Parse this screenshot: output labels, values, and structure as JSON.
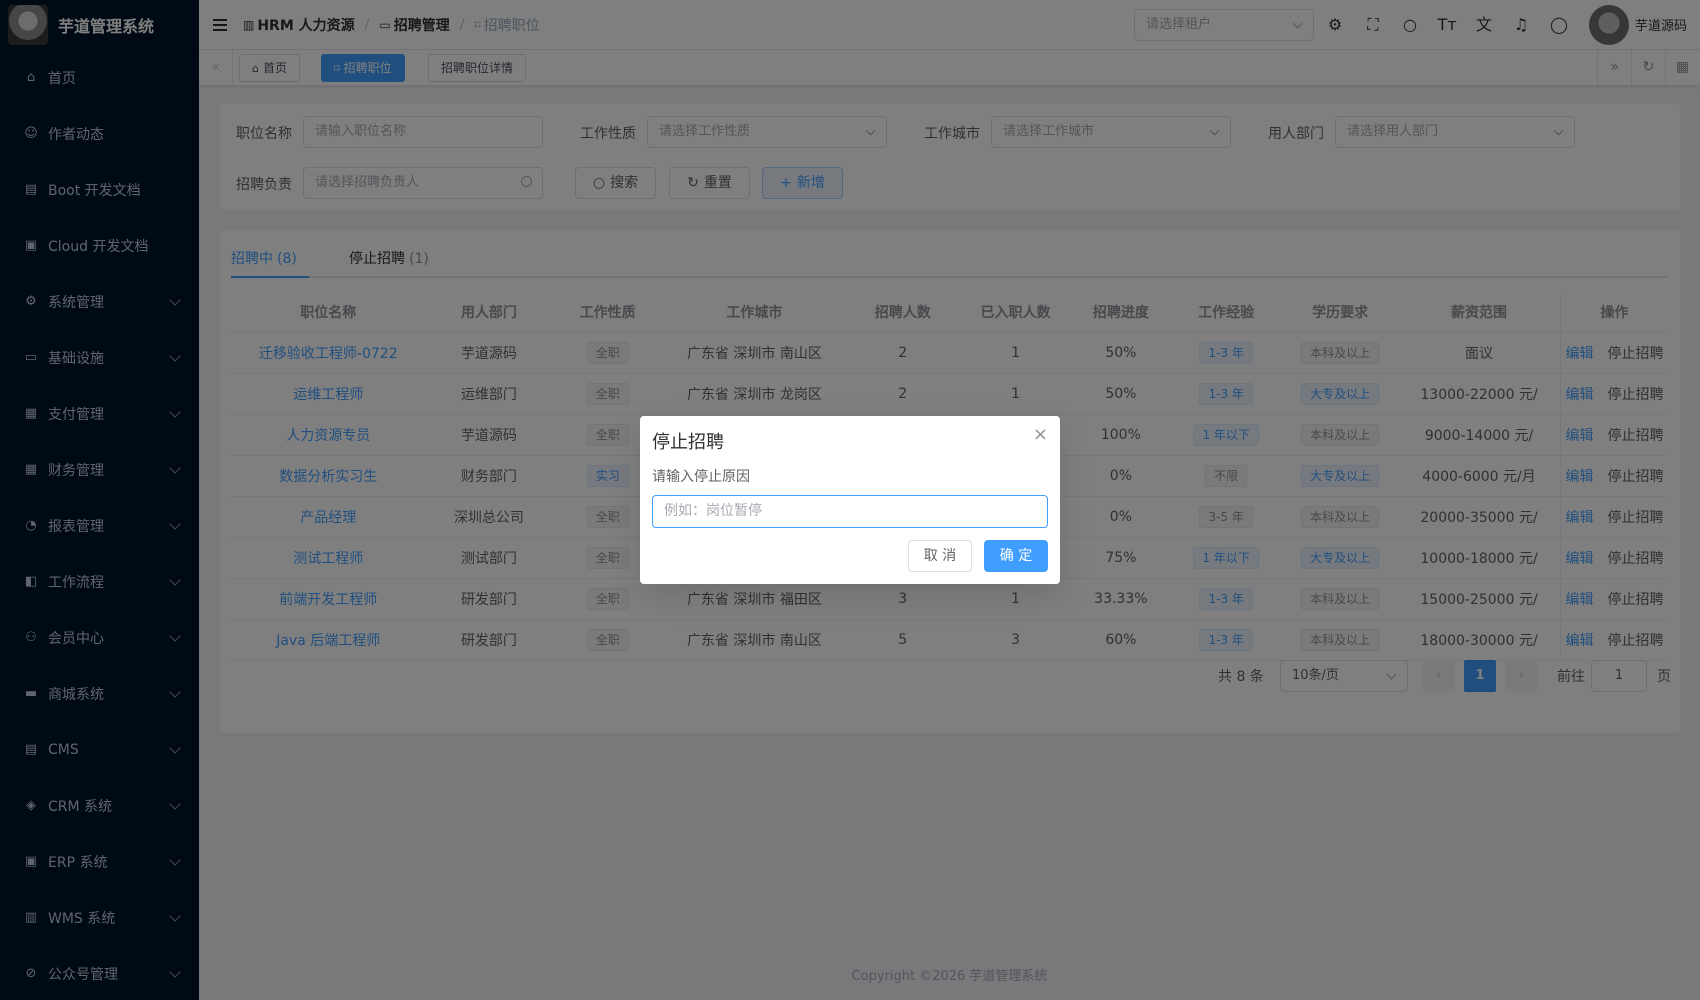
{
  "app": {
    "title": "芋道管理系统"
  },
  "sidebar": {
    "items": [
      {
        "label": "首页",
        "icon": "home-icon",
        "glyph": "⌂",
        "expandable": false
      },
      {
        "label": "作者动态",
        "icon": "user-icon",
        "glyph": "☺",
        "expandable": false
      },
      {
        "label": "Boot 开发文档",
        "icon": "document-icon",
        "glyph": "▤",
        "expandable": false
      },
      {
        "label": "Cloud 开发文档",
        "icon": "document-copy-icon",
        "glyph": "▣",
        "expandable": false
      },
      {
        "label": "系统管理",
        "icon": "gear-icon",
        "glyph": "⚙",
        "expandable": true
      },
      {
        "label": "基础设施",
        "icon": "monitor-icon",
        "glyph": "▭",
        "expandable": true
      },
      {
        "label": "支付管理",
        "icon": "wallet-icon",
        "glyph": "▦",
        "expandable": true
      },
      {
        "label": "财务管理",
        "icon": "finance-icon",
        "glyph": "▦",
        "expandable": true
      },
      {
        "label": "报表管理",
        "icon": "pie-chart-icon",
        "glyph": "◔",
        "expandable": true
      },
      {
        "label": "工作流程",
        "icon": "workflow-icon",
        "glyph": "◧",
        "expandable": true
      },
      {
        "label": "会员中心",
        "icon": "member-icon",
        "glyph": "⚇",
        "expandable": true
      },
      {
        "label": "商城系统",
        "icon": "shop-icon",
        "glyph": "▬",
        "expandable": true
      },
      {
        "label": "CMS",
        "icon": "cms-icon",
        "glyph": "▤",
        "expandable": true
      },
      {
        "label": "CRM 系统",
        "icon": "crm-icon",
        "glyph": "◈",
        "expandable": true
      },
      {
        "label": "ERP 系统",
        "icon": "erp-icon",
        "glyph": "▣",
        "expandable": true
      },
      {
        "label": "WMS 系统",
        "icon": "warehouse-icon",
        "glyph": "▥",
        "expandable": true
      },
      {
        "label": "公众号管理",
        "icon": "wechat-icon",
        "glyph": "⊘",
        "expandable": true
      }
    ]
  },
  "header": {
    "breadcrumb": [
      "HRM 人力资源",
      "招聘管理",
      "招聘职位"
    ],
    "tenant_placeholder": "请选择租户",
    "user_name": "芋道源码"
  },
  "tags": [
    {
      "label": "首页",
      "active": false
    },
    {
      "label": "招聘职位",
      "active": true
    },
    {
      "label": "招聘职位详情",
      "active": false
    }
  ],
  "search": {
    "job_name_label": "职位名称",
    "job_name_placeholder": "请输入职位名称",
    "job_nature_label": "工作性质",
    "job_nature_placeholder": "请选择工作性质",
    "city_label": "工作城市",
    "city_placeholder": "请选择工作城市",
    "dept_label": "用人部门",
    "dept_placeholder": "请选择用人部门",
    "owner_label": "招聘负责",
    "owner_placeholder": "请选择招聘负责人",
    "search_btn": "搜索",
    "reset_btn": "重置",
    "add_btn": "新增"
  },
  "tabs": [
    {
      "label": "招聘中",
      "count": "(8)",
      "active": true
    },
    {
      "label": "停止招聘",
      "count": "(1)",
      "active": false
    }
  ],
  "table": {
    "columns": [
      "职位名称",
      "用人部门",
      "工作性质",
      "工作城市",
      "招聘人数",
      "已入职人数",
      "招聘进度",
      "工作经验",
      "学历要求",
      "薪资范围",
      "操作"
    ],
    "edit_label": "编辑",
    "stop_label": "停止招聘",
    "rows": [
      {
        "name": "迁移验收工程师-0722",
        "dept": "芋道源码",
        "nature": "全职",
        "nature_blue": false,
        "city": "广东省 深圳市 南山区",
        "headcount": "2",
        "hired": "1",
        "progress": "50%",
        "exp": "1-3 年",
        "exp_blue": true,
        "edu": "本科及以上",
        "edu_blue": false,
        "salary": "面议"
      },
      {
        "name": "运维工程师",
        "dept": "运维部门",
        "nature": "全职",
        "nature_blue": false,
        "city": "广东省 深圳市 龙岗区",
        "headcount": "2",
        "hired": "1",
        "progress": "50%",
        "exp": "1-3 年",
        "exp_blue": true,
        "edu": "大专及以上",
        "edu_blue": true,
        "salary": "13000-22000 元/"
      },
      {
        "name": "人力资源专员",
        "dept": "芋道源码",
        "nature": "全职",
        "nature_blue": false,
        "city": "",
        "headcount": "",
        "hired": "",
        "progress": "100%",
        "exp": "1 年以下",
        "exp_blue": true,
        "edu": "本科及以上",
        "edu_blue": false,
        "salary": "9000-14000 元/"
      },
      {
        "name": "数据分析实习生",
        "dept": "财务部门",
        "nature": "实习",
        "nature_blue": true,
        "city": "",
        "headcount": "",
        "hired": "",
        "progress": "0%",
        "exp": "不限",
        "exp_blue": false,
        "edu": "大专及以上",
        "edu_blue": true,
        "salary": "4000-6000 元/月"
      },
      {
        "name": "产品经理",
        "dept": "深圳总公司",
        "nature": "全职",
        "nature_blue": false,
        "city": "",
        "headcount": "",
        "hired": "",
        "progress": "0%",
        "exp": "3-5 年",
        "exp_blue": false,
        "edu": "本科及以上",
        "edu_blue": false,
        "salary": "20000-35000 元/"
      },
      {
        "name": "测试工程师",
        "dept": "测试部门",
        "nature": "全职",
        "nature_blue": false,
        "city": "",
        "headcount": "",
        "hired": "",
        "progress": "75%",
        "exp": "1 年以下",
        "exp_blue": true,
        "edu": "大专及以上",
        "edu_blue": true,
        "salary": "10000-18000 元/"
      },
      {
        "name": "前端开发工程师",
        "dept": "研发部门",
        "nature": "全职",
        "nature_blue": false,
        "city": "广东省 深圳市 福田区",
        "headcount": "3",
        "hired": "1",
        "progress": "33.33%",
        "exp": "1-3 年",
        "exp_blue": true,
        "edu": "本科及以上",
        "edu_blue": false,
        "salary": "15000-25000 元/"
      },
      {
        "name": "Java 后端工程师",
        "dept": "研发部门",
        "nature": "全职",
        "nature_blue": false,
        "city": "广东省 深圳市 南山区",
        "headcount": "5",
        "hired": "3",
        "progress": "60%",
        "exp": "1-3 年",
        "exp_blue": true,
        "edu": "本科及以上",
        "edu_blue": false,
        "salary": "18000-30000 元/"
      }
    ]
  },
  "pagination": {
    "total": "共 8 条",
    "page_size": "10条/页",
    "prev": "‹",
    "current": "1",
    "next": "›",
    "goto_label": "前往",
    "goto_value": "1",
    "page_suffix": "页"
  },
  "footer": {
    "copyright": "Copyright ©2026 芋道管理系统"
  },
  "dialog": {
    "title": "停止招聘",
    "close": "×",
    "label": "请输入停止原因",
    "placeholder": "例如：岗位暂停",
    "cancel": "取 消",
    "confirm": "确 定"
  },
  "colors": {
    "primary": "#409eff",
    "sidebar_bg": "#001529",
    "overlay": "rgba(0,0,0,0.5)"
  }
}
